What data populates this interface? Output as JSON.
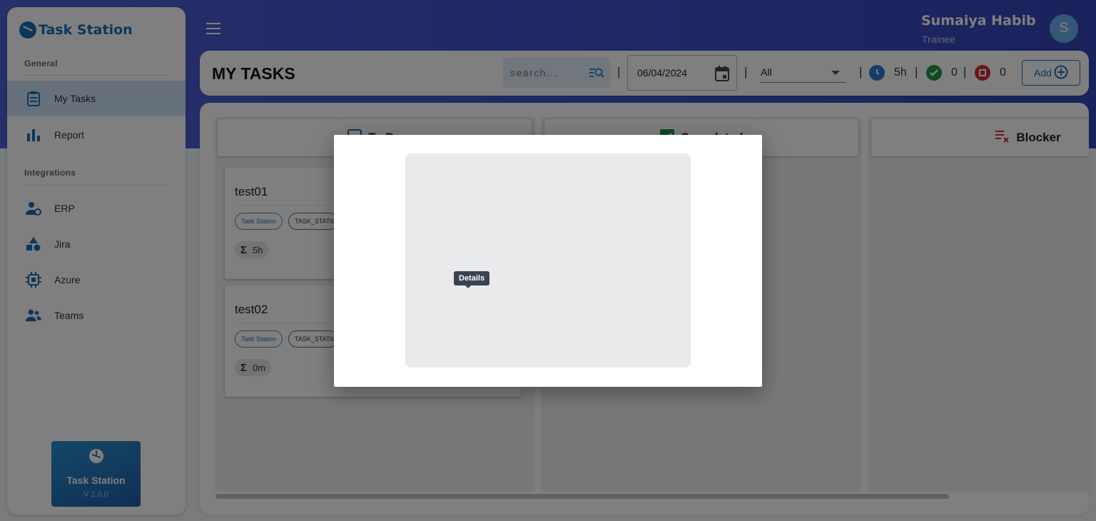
{
  "app": {
    "logo_text": "Task Station"
  },
  "sidebar": {
    "general_title": "General",
    "integrations_title": "Integrations",
    "items": [
      {
        "label": "My Tasks",
        "icon": "clipboard-icon"
      },
      {
        "label": "Report",
        "icon": "bar-chart-icon"
      },
      {
        "label": "ERP",
        "icon": "user-gear-icon"
      },
      {
        "label": "Jira",
        "icon": "shapes-icon"
      },
      {
        "label": "Azure",
        "icon": "chip-icon"
      },
      {
        "label": "Teams",
        "icon": "team-icon"
      }
    ],
    "badge": {
      "title": "Task Station",
      "version": "V 2.0.0"
    }
  },
  "header": {
    "user_name": "Sumaiya Habib",
    "user_role": "Trainee",
    "avatar_initial": "S"
  },
  "toolbar": {
    "title": "MY TASKS",
    "search_placeholder": "search...",
    "date": "06/04/2024",
    "filter": "All",
    "hours": "5h",
    "done_count": "0",
    "blocked_count": "0",
    "add_label": "Add",
    "separator": "|"
  },
  "columns": [
    {
      "title": "To Do"
    },
    {
      "title": "Completed"
    },
    {
      "title": "Blocker"
    }
  ],
  "cards": [
    {
      "title": "test01",
      "project": "Task Station",
      "key": "TASK_STATION",
      "duration": "5h"
    },
    {
      "title": "test02",
      "project": "Task Station",
      "key": "TASK_STATION",
      "duration": "0m"
    }
  ],
  "modal": {
    "tooltip": "Details"
  },
  "colors": {
    "brand": "#1a6fb4",
    "header_gradient": "#4a5bd4",
    "done": "#1a9a3a",
    "blocked": "#d32f2f"
  }
}
